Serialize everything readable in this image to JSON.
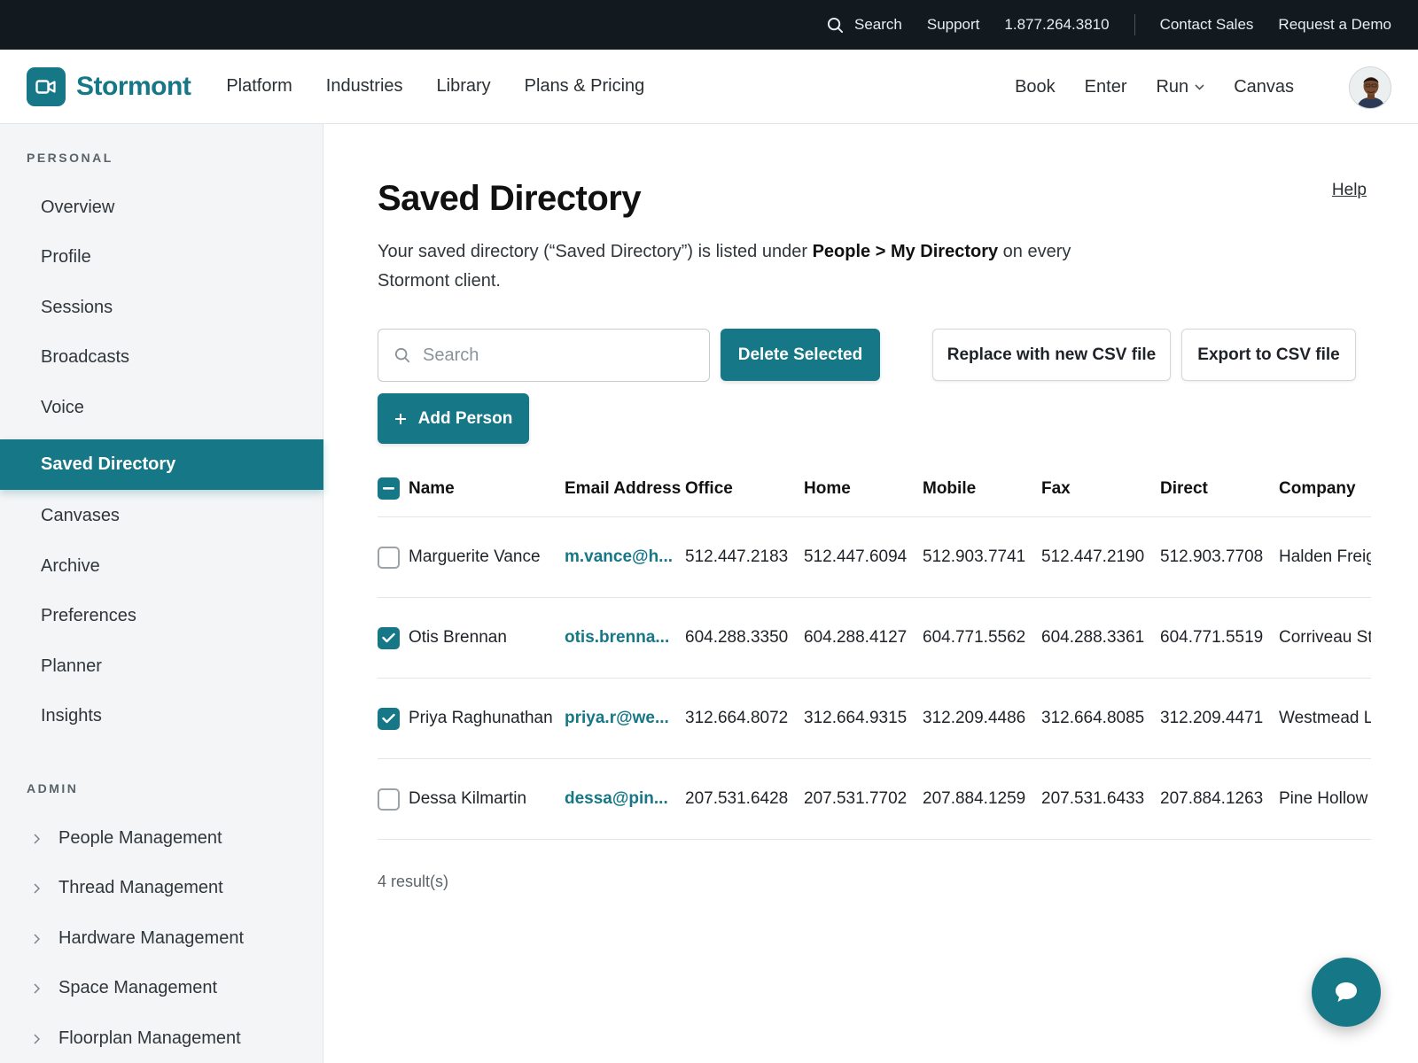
{
  "topbar": {
    "search_label": "Search",
    "support_label": "Support",
    "phone": "1.877.264.3810",
    "contact_sales": "Contact Sales",
    "request_demo": "Request a Demo"
  },
  "header": {
    "brand": "Stormont",
    "nav": [
      "Platform",
      "Industries",
      "Library",
      "Plans & Pricing"
    ],
    "right_nav": [
      "Book",
      "Enter",
      "Run",
      "Canvas"
    ]
  },
  "sidebar": {
    "personal_label": "PERSONAL",
    "items": [
      "Overview",
      "Profile",
      "Sessions",
      "Broadcasts",
      "Voice",
      "Saved Directory",
      "Canvases",
      "Archive",
      "Preferences",
      "Planner",
      "Insights"
    ],
    "active_index": 5,
    "admin_label": "ADMIN",
    "admin_items": [
      "People Management",
      "Thread Management",
      "Hardware Management",
      "Space Management",
      "Floorplan Management"
    ]
  },
  "main": {
    "title": "Saved Directory",
    "help": "Help",
    "intro_before": "Your saved directory (“Saved Directory”) is listed under ",
    "intro_bold": "People > My Directory",
    "intro_after": " on every Stormont client.",
    "search_placeholder": "Search",
    "delete_selected": "Delete Selected",
    "replace_csv": "Replace with new CSV file",
    "export_csv": "Export to CSV file",
    "add_person": "Add Person",
    "results": "4 result(s)"
  },
  "table": {
    "columns": [
      "Name",
      "Email Address",
      "Office",
      "Home",
      "Mobile",
      "Fax",
      "Direct",
      "Company"
    ],
    "rows": [
      {
        "checked": false,
        "name": "Marguerite Vance",
        "email": "m.vance@h...",
        "office": "512.447.2183",
        "home": "512.447.6094",
        "mobile": "512.903.7741",
        "fax": "512.447.2190",
        "direct": "512.903.7708",
        "company": "Halden Freig"
      },
      {
        "checked": true,
        "name": "Otis Brennan",
        "email": "otis.brenna...",
        "office": "604.288.3350",
        "home": "604.288.4127",
        "mobile": "604.771.5562",
        "fax": "604.288.3361",
        "direct": "604.771.5519",
        "company": "Corriveau St"
      },
      {
        "checked": true,
        "name": "Priya Raghunathan",
        "email": "priya.r@we...",
        "office": "312.664.8072",
        "home": "312.664.9315",
        "mobile": "312.209.4486",
        "fax": "312.664.8085",
        "direct": "312.209.4471",
        "company": "Westmead L"
      },
      {
        "checked": false,
        "name": "Dessa Kilmartin",
        "email": "dessa@pin...",
        "office": "207.531.6428",
        "home": "207.531.7702",
        "mobile": "207.884.1259",
        "fax": "207.531.6433",
        "direct": "207.884.1263",
        "company": "Pine Hollow"
      }
    ]
  },
  "colors": {
    "accent": "#167787",
    "topbar_bg": "#121a20",
    "sidebar_bg": "#f4f5f6"
  },
  "icons": {
    "search": "search-icon",
    "chevron_down": "chevron-down-icon",
    "chevron_right": "chevron-right-icon",
    "plus": "plus-icon",
    "chat": "chat-bubble-icon",
    "logo": "video-camera-icon"
  }
}
